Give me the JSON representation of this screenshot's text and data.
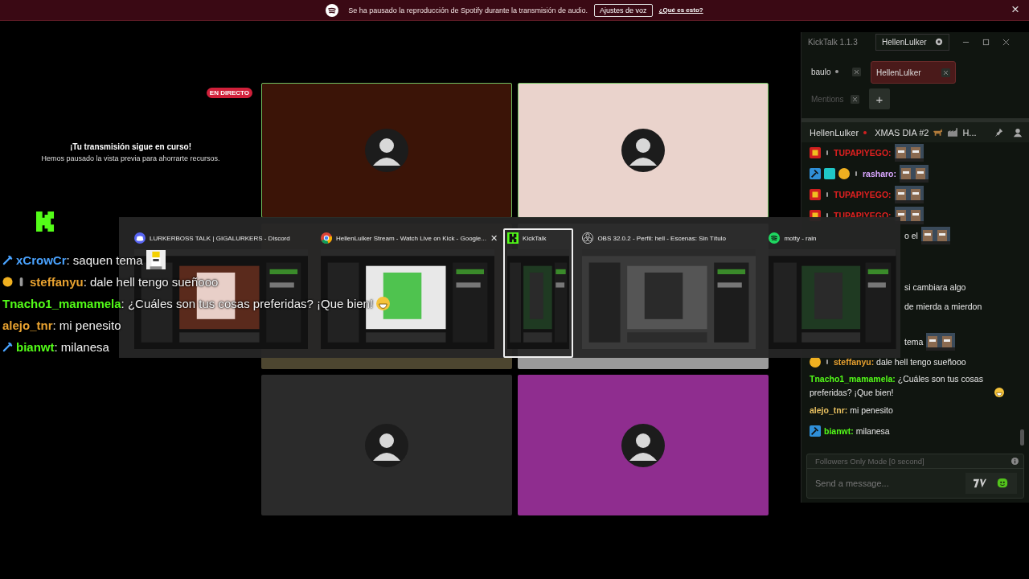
{
  "banner": {
    "message": "Se ha pausado la reproducción de Spotify durante la transmisión de audio.",
    "button": "Ajustes de voz",
    "link": "¿Qué es esto?",
    "close": "×"
  },
  "stage": {
    "live_badge": "EN DIRECTO",
    "heading": "¡Tu transmisión sigue en curso!",
    "subheading": "Hemos pausado la vista previa para ahorrarte recursos.",
    "tiles": [
      {
        "color": "#3b1407",
        "speaking": true,
        "avatar": true
      },
      {
        "color": "#ead3cc",
        "speaking": true,
        "avatar": true
      },
      {
        "color": "#4d4630",
        "speaking": false
      },
      {
        "color": "#9a9a9a",
        "speaking": false
      },
      {
        "color": "#2b2b2b",
        "speaking": false,
        "avatar": true
      },
      {
        "color": "#8f2d8f",
        "speaking": false,
        "avatar": true
      }
    ]
  },
  "overlay_chat": [
    {
      "badges": [
        {
          "kind": "mod"
        }
      ],
      "user": "xCrowCr",
      "text": ": saquen tema",
      "color": "#4aa3ff",
      "emote": true
    },
    {
      "badges": [
        {
          "kind": "sub"
        },
        {
          "kind": "pin"
        }
      ],
      "user": "steffanyu",
      "text": ": dale hell tengo sueñooo",
      "color": "#e8a230"
    },
    {
      "user": "Tnacho1_mamamela",
      "text": ": ¿Cuáles son tus cosas preferidas? ¡Que bien!",
      "color": "#53fc18",
      "emoji": true
    },
    {
      "user": "alejo_tnr",
      "text": ": mi penesito",
      "color": "#e8a230"
    },
    {
      "badges": [
        {
          "kind": "mod"
        }
      ],
      "user": "bianwt",
      "text": ": milanesa",
      "color": "#53fc18"
    }
  ],
  "switcher": [
    {
      "kind": "discord",
      "title": "LURKERBOSS TALK | GIGALURKERS - Discord",
      "selected": false
    },
    {
      "kind": "chrome",
      "title": "HellenLulker Stream - Watch Live on Kick - Google...",
      "selected": false,
      "close": "✕"
    },
    {
      "kind": "kick",
      "title": "KickTalk",
      "selected": true
    },
    {
      "kind": "obs",
      "title": "OBS 32.0.2 - Perfil: hell - Escenas: Sin Título",
      "selected": false
    },
    {
      "kind": "spotify",
      "title": "motty - rain",
      "selected": false
    }
  ],
  "kicktalk": {
    "title": "KickTalk 1.1.3",
    "user": "HellenLulker",
    "tabs": [
      {
        "label": "baulo",
        "selected": false,
        "live": true,
        "dim": false
      },
      {
        "label": "HellenLulker",
        "selected": true,
        "live": false,
        "dim": false
      },
      {
        "label": "Mentions",
        "selected": false,
        "live": false,
        "dim": true
      }
    ],
    "add": "+",
    "channel": {
      "name": "HellenLulker",
      "live": true,
      "stream_title": "XMAS DIA #2",
      "title_end": "H..."
    },
    "messages": [
      {
        "kind": "message",
        "badges": [
          {
            "kind": "gifter"
          },
          {
            "kind": "pin"
          }
        ],
        "user": "TUPAPIYEGO:",
        "color": "#e02020",
        "emote": true
      },
      {
        "kind": "message",
        "badges": [
          {
            "kind": "mod"
          },
          {
            "kind": "og"
          },
          {
            "kind": "sub"
          },
          {
            "kind": "pin"
          }
        ],
        "user": "rasharo:",
        "color": "#d9a6ff",
        "emote": true
      },
      {
        "kind": "message",
        "badges": [
          {
            "kind": "gifter"
          },
          {
            "kind": "pin"
          }
        ],
        "user": "TUPAPIYEGO:",
        "color": "#e02020",
        "emote": true
      },
      {
        "kind": "message",
        "badges": [
          {
            "kind": "gifter"
          },
          {
            "kind": "pin"
          }
        ],
        "user": "TUPAPIYEGO:",
        "color": "#e02020",
        "emote": true
      },
      {
        "kind": "fragment",
        "text": "o el",
        "emote": true
      },
      {
        "kind": "fragment",
        "text": "si cambiara algo"
      },
      {
        "kind": "fragment",
        "text": "de mierda a mierdon"
      },
      {
        "kind": "fragment",
        "text": "tema",
        "emote": true
      },
      {
        "kind": "message",
        "badges": [
          {
            "kind": "sub"
          },
          {
            "kind": "pin"
          }
        ],
        "user": "steffanyu:",
        "color": "#e8a230",
        "text": "dale hell tengo sueñooo"
      },
      {
        "kind": "message",
        "user": "Tnacho1_mamamela:",
        "color": "#53fc18",
        "text": "¿Cuáles son tus cosas preferidas? ¡Que bien!",
        "emoji": true
      },
      {
        "kind": "message",
        "user": "alejo_tnr:",
        "color": "#e8c060",
        "text": "mi penesito"
      },
      {
        "kind": "message",
        "badges": [
          {
            "kind": "mod"
          }
        ],
        "user": "bianwt:",
        "color": "#53fc18",
        "text": "milanesa"
      }
    ],
    "mode": "Followers Only Mode [0 second]",
    "input": {
      "placeholder": "Send a message..."
    }
  }
}
